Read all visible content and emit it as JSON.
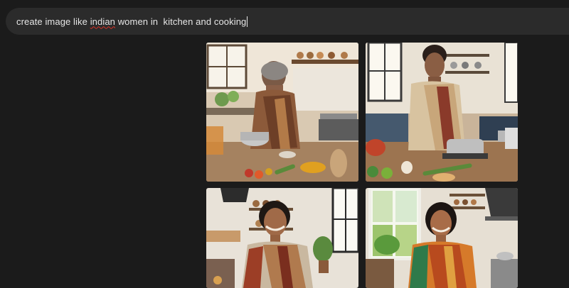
{
  "prompt": {
    "before": "create image like ",
    "misspelled_word": "indian",
    "after": " women in  kitchen and cooking"
  },
  "results": [
    {
      "id": "result-1",
      "subject": "older woman in brown saree stirring pot"
    },
    {
      "id": "result-2",
      "subject": "woman in beige saree stirring pot on stove"
    },
    {
      "id": "result-3",
      "subject": "smiling woman in striped saree"
    },
    {
      "id": "result-4",
      "subject": "smiling woman in orange saree"
    }
  ],
  "colors": {
    "background": "#1b1b1b",
    "prompt_bar": "#2b2b2b",
    "prompt_text": "#e6e6e6",
    "spellcheck": "#d93025"
  }
}
